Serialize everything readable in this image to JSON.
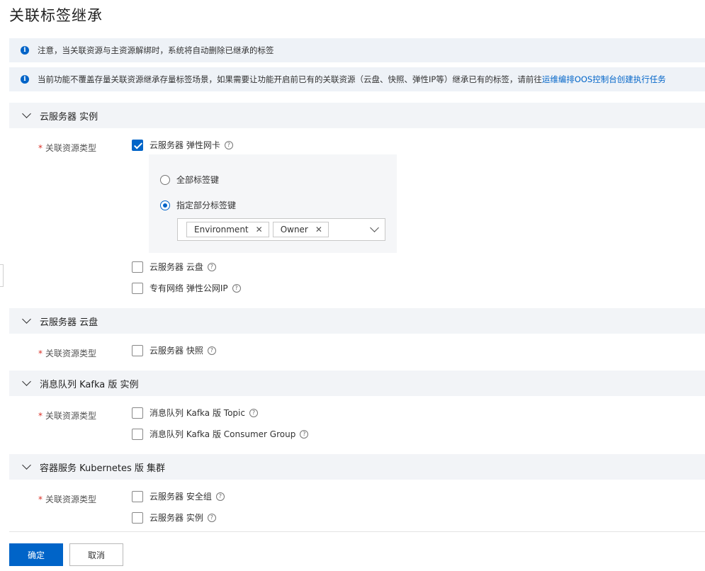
{
  "title": "关联标签继承",
  "notices": [
    {
      "text": "注意，当关联资源与主资源解绑时，系统将自动删除已继承的标签",
      "link": ""
    },
    {
      "text": "当前功能不覆盖存量关联资源继承存量标签场景，如果需要让功能开启前已有的关联资源（云盘、快照、弹性IP等）继承已有的标签，请前往 ",
      "link": "运维编排OOS控制台创建执行任务"
    }
  ],
  "form_label": "关联资源类型",
  "sections": [
    {
      "header": "云服务器 实例",
      "options": [
        {
          "label": "云服务器 弹性网卡",
          "checked": true
        },
        {
          "label": "云服务器 云盘",
          "checked": false
        },
        {
          "label": "专有网络 弹性公网IP",
          "checked": false
        }
      ],
      "sub": {
        "radio_all": "全部标签键",
        "radio_specific": "指定部分标签键",
        "selected": "specific",
        "tags": [
          "Environment",
          "Owner"
        ]
      }
    },
    {
      "header": "云服务器 云盘",
      "options": [
        {
          "label": "云服务器 快照",
          "checked": false
        }
      ]
    },
    {
      "header": "消息队列 Kafka 版 实例",
      "options": [
        {
          "label": "消息队列 Kafka 版 Topic",
          "checked": false
        },
        {
          "label": "消息队列 Kafka 版 Consumer Group",
          "checked": false
        }
      ]
    },
    {
      "header": "容器服务 Kubernetes 版 集群",
      "options": [
        {
          "label": "云服务器 安全组",
          "checked": false
        },
        {
          "label": "云服务器 实例",
          "checked": false
        }
      ]
    }
  ],
  "buttons": {
    "confirm": "确定",
    "cancel": "取消"
  },
  "icons": {
    "info": "info-icon",
    "help": "help-icon",
    "close": "close-icon",
    "chevron": "chevron-down-icon"
  },
  "colors": {
    "primary": "#0064c8",
    "required": "#d93026"
  }
}
